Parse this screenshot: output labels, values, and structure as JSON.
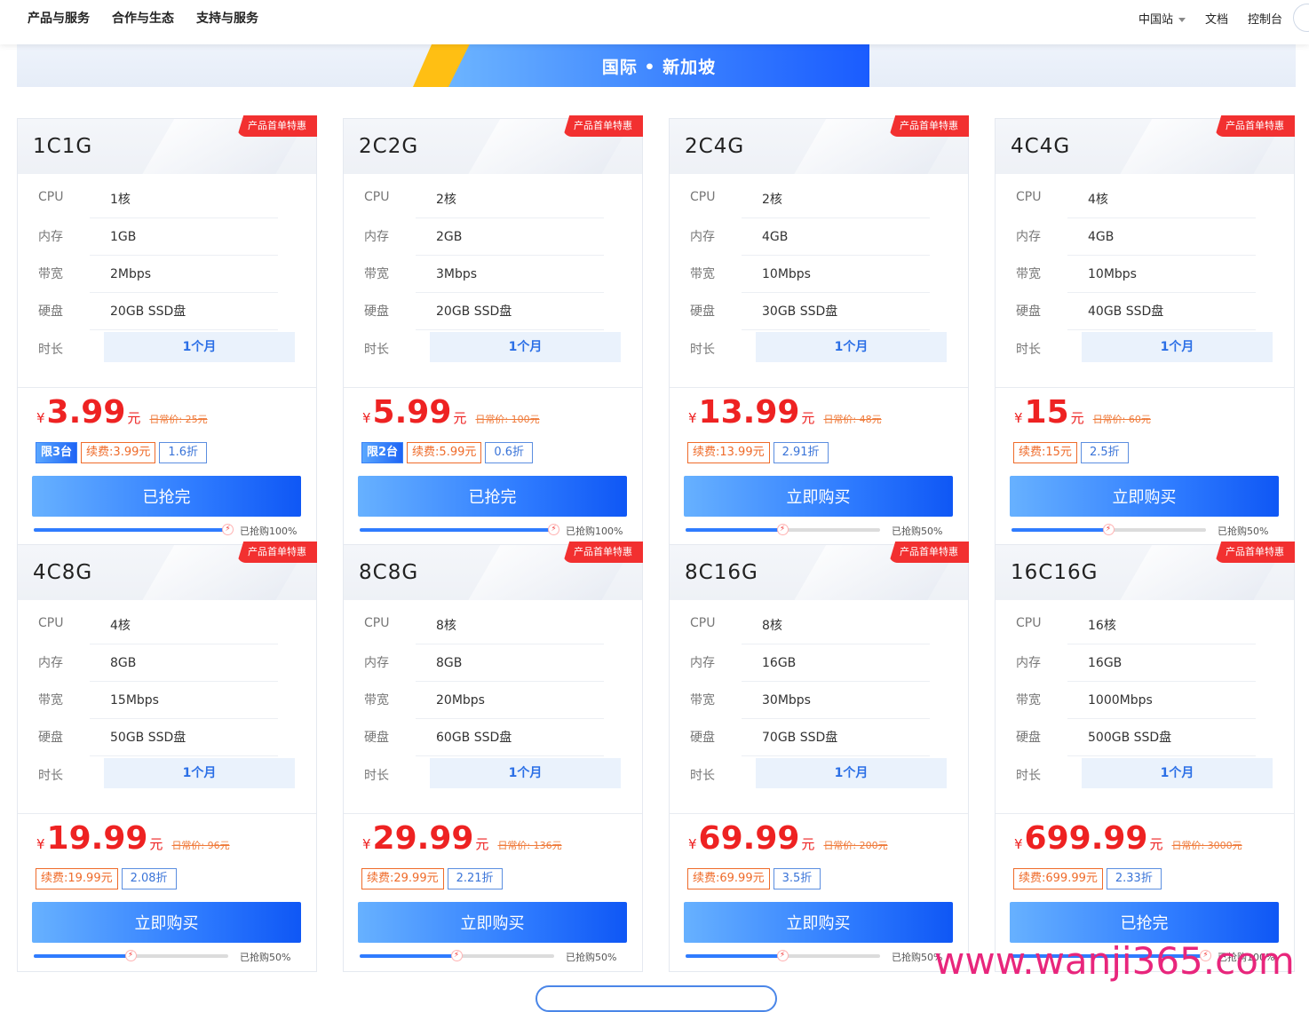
{
  "nav": {
    "left": [
      "产品与服务",
      "合作与生态",
      "支持与服务"
    ],
    "region_select": "中国站",
    "docs": "文档",
    "console": "控制台"
  },
  "region_tab": "国际 • 新加坡",
  "spec_labels": {
    "cpu": "CPU",
    "memory": "内存",
    "bandwidth": "带宽",
    "disk": "硬盘",
    "duration": "时长"
  },
  "badge": "产品首单特惠",
  "currency": "¥",
  "unit": "元",
  "cards": [
    {
      "title": "1C1G",
      "cpu": "1核",
      "memory": "1GB",
      "bandwidth": "2Mbps",
      "disk": "20GB SSD盘",
      "duration": "1个月",
      "price": "3.99",
      "orig": "日常价: 25元",
      "limit": "限3台",
      "renew": "续费:3.99元",
      "discount": "1.6折",
      "button": "已抢完",
      "progress": 100,
      "sold": "已抢购100%"
    },
    {
      "title": "2C2G",
      "cpu": "2核",
      "memory": "2GB",
      "bandwidth": "3Mbps",
      "disk": "20GB SSD盘",
      "duration": "1个月",
      "price": "5.99",
      "orig": "日常价: 100元",
      "limit": "限2台",
      "renew": "续费:5.99元",
      "discount": "0.6折",
      "button": "已抢完",
      "progress": 100,
      "sold": "已抢购100%"
    },
    {
      "title": "2C4G",
      "cpu": "2核",
      "memory": "4GB",
      "bandwidth": "10Mbps",
      "disk": "30GB SSD盘",
      "duration": "1个月",
      "price": "13.99",
      "orig": "日常价: 48元",
      "limit": "",
      "renew": "续费:13.99元",
      "discount": "2.91折",
      "button": "立即购买",
      "progress": 50,
      "sold": "已抢购50%"
    },
    {
      "title": "4C4G",
      "cpu": "4核",
      "memory": "4GB",
      "bandwidth": "10Mbps",
      "disk": "40GB SSD盘",
      "duration": "1个月",
      "price": "15",
      "orig": "日常价: 60元",
      "limit": "",
      "renew": "续费:15元",
      "discount": "2.5折",
      "button": "立即购买",
      "progress": 50,
      "sold": "已抢购50%"
    },
    {
      "title": "4C8G",
      "cpu": "4核",
      "memory": "8GB",
      "bandwidth": "15Mbps",
      "disk": "50GB SSD盘",
      "duration": "1个月",
      "price": "19.99",
      "orig": "日常价: 96元",
      "limit": "",
      "renew": "续费:19.99元",
      "discount": "2.08折",
      "button": "立即购买",
      "progress": 50,
      "sold": "已抢购50%"
    },
    {
      "title": "8C8G",
      "cpu": "8核",
      "memory": "8GB",
      "bandwidth": "20Mbps",
      "disk": "60GB SSD盘",
      "duration": "1个月",
      "price": "29.99",
      "orig": "日常价: 136元",
      "limit": "",
      "renew": "续费:29.99元",
      "discount": "2.21折",
      "button": "立即购买",
      "progress": 50,
      "sold": "已抢购50%"
    },
    {
      "title": "8C16G",
      "cpu": "8核",
      "memory": "16GB",
      "bandwidth": "30Mbps",
      "disk": "70GB SSD盘",
      "duration": "1个月",
      "price": "69.99",
      "orig": "日常价: 200元",
      "limit": "",
      "renew": "续费:69.99元",
      "discount": "3.5折",
      "button": "立即购买",
      "progress": 50,
      "sold": "已抢购50%"
    },
    {
      "title": "16C16G",
      "cpu": "16核",
      "memory": "16GB",
      "bandwidth": "1000Mbps",
      "disk": "500GB SSD盘",
      "duration": "1个月",
      "price": "699.99",
      "orig": "日常价: 3000元",
      "limit": "",
      "renew": "续费:699.99元",
      "discount": "2.33折",
      "button": "已抢完",
      "progress": 100,
      "sold": "已抢购100%"
    }
  ],
  "watermark": "www.wanji365.com"
}
